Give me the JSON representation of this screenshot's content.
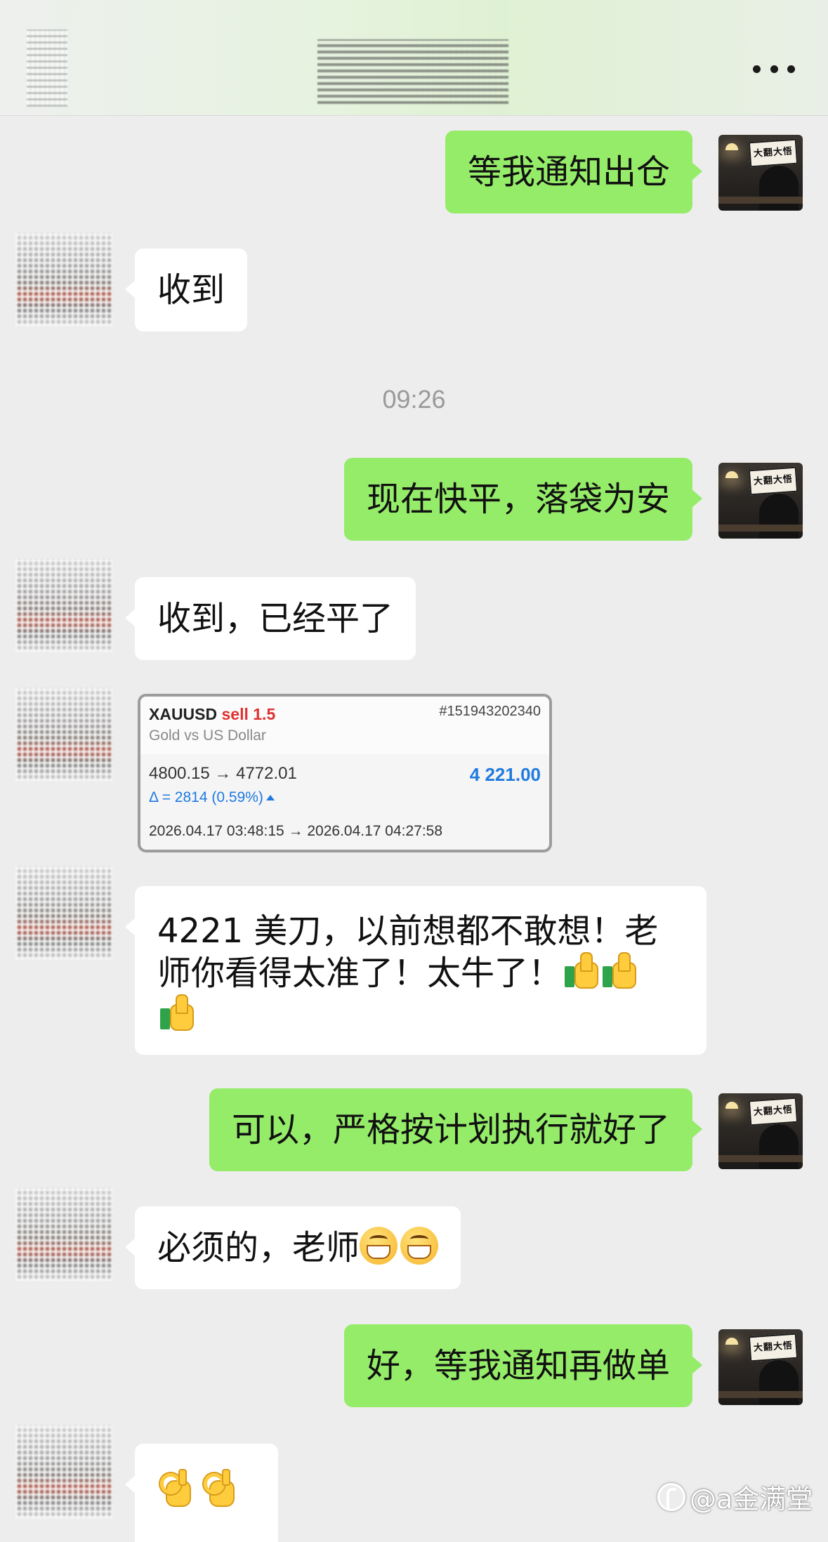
{
  "header": {
    "more_icon": "more-dots-icon",
    "back_icon": "back-arrow-icon"
  },
  "messages": [
    {
      "from": "me",
      "text": "等我通知出仓"
    },
    {
      "from": "them",
      "text": "收到"
    },
    {
      "type": "time",
      "text": "09:26"
    },
    {
      "from": "me",
      "text": "现在快平，落袋为安"
    },
    {
      "from": "them",
      "text": "收到，已经平了"
    },
    {
      "from": "them",
      "type": "trade_card"
    },
    {
      "from": "them",
      "text_line1": "4221 美刀，以前想都不敢想！老",
      "text_line2": "师你看得太准了！太牛了！",
      "emoji": [
        "thumbs-up",
        "thumbs-up",
        "thumbs-up"
      ]
    },
    {
      "from": "me",
      "text": "可以，严格按计划执行就好了"
    },
    {
      "from": "them",
      "text": "必须的，老师",
      "emoji": [
        "grinning-face",
        "grinning-face"
      ]
    },
    {
      "from": "me",
      "text": "好，等我通知再做单"
    },
    {
      "from": "them",
      "emoji": [
        "ok-hand",
        "ok-hand"
      ]
    }
  ],
  "trade_card": {
    "symbol": "XAUUSD",
    "side": "sell 1.5",
    "ticket": "#151943202340",
    "description": "Gold vs US Dollar",
    "prices": "4800.15 → 4772.01",
    "profit": "4 221.00",
    "delta": "Δ = 2814 (0.59%)",
    "dates": "2026.04.17 03:48:15 → 2026.04.17 04:27:58"
  },
  "avatar_me_sign": "大翻大悟",
  "watermark": "@a金满堂",
  "colors": {
    "bubble_me": "#95ec69",
    "bubble_them": "#ffffff",
    "background": "#ededed",
    "sell": "#e03030",
    "profit": "#1f7ae0"
  }
}
